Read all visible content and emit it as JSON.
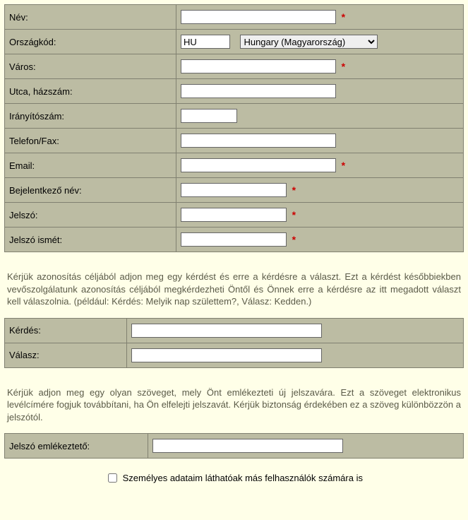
{
  "fields": {
    "name": {
      "label": "Név:",
      "value": "",
      "required": true
    },
    "country": {
      "label": "Országkód:",
      "code": "HU",
      "selected": "Hungary (Magyarország)"
    },
    "city": {
      "label": "Város:",
      "value": "",
      "required": true
    },
    "address": {
      "label": "Utca, házszám:",
      "value": ""
    },
    "zip": {
      "label": "Irányítószám:",
      "value": ""
    },
    "phone": {
      "label": "Telefon/Fax:",
      "value": ""
    },
    "email": {
      "label": "Email:",
      "value": "",
      "required": true
    },
    "login": {
      "label": "Bejelentkező név:",
      "value": "",
      "required": true
    },
    "password": {
      "label": "Jelszó:",
      "value": "",
      "required": true
    },
    "password2": {
      "label": "Jelszó ismét:",
      "value": "",
      "required": true
    },
    "question": {
      "label": "Kérdés:",
      "value": ""
    },
    "answer": {
      "label": "Válasz:",
      "value": ""
    },
    "reminder": {
      "label": "Jelszó emlékeztető:",
      "value": ""
    }
  },
  "texts": {
    "paragraph1": "Kérjük azonosítás céljából adjon meg egy kérdést és erre a kérdésre a választ. Ezt a kérdést későbbiekben vevőszolgálatunk azonosítás céljából megkérdezheti Öntől és Önnek erre a kérdésre az itt megadott választ kell válaszolnia. (például: Kérdés: Melyik nap születtem?, Válasz: Kedden.)",
    "paragraph2": "Kérjük adjon meg egy olyan szöveget, mely Önt emlékezteti új jelszavára. Ezt a szöveget elektronikus levélcímére fogjuk továbbítani, ha Ön elfelejti jelszavát. Kérjük biztonság érdekében ez a szöveg különbözzön a jelszótól.",
    "visibility_checkbox": "Személyes adataim láthatóak más felhasználók számára is"
  },
  "misc": {
    "star": "*"
  }
}
